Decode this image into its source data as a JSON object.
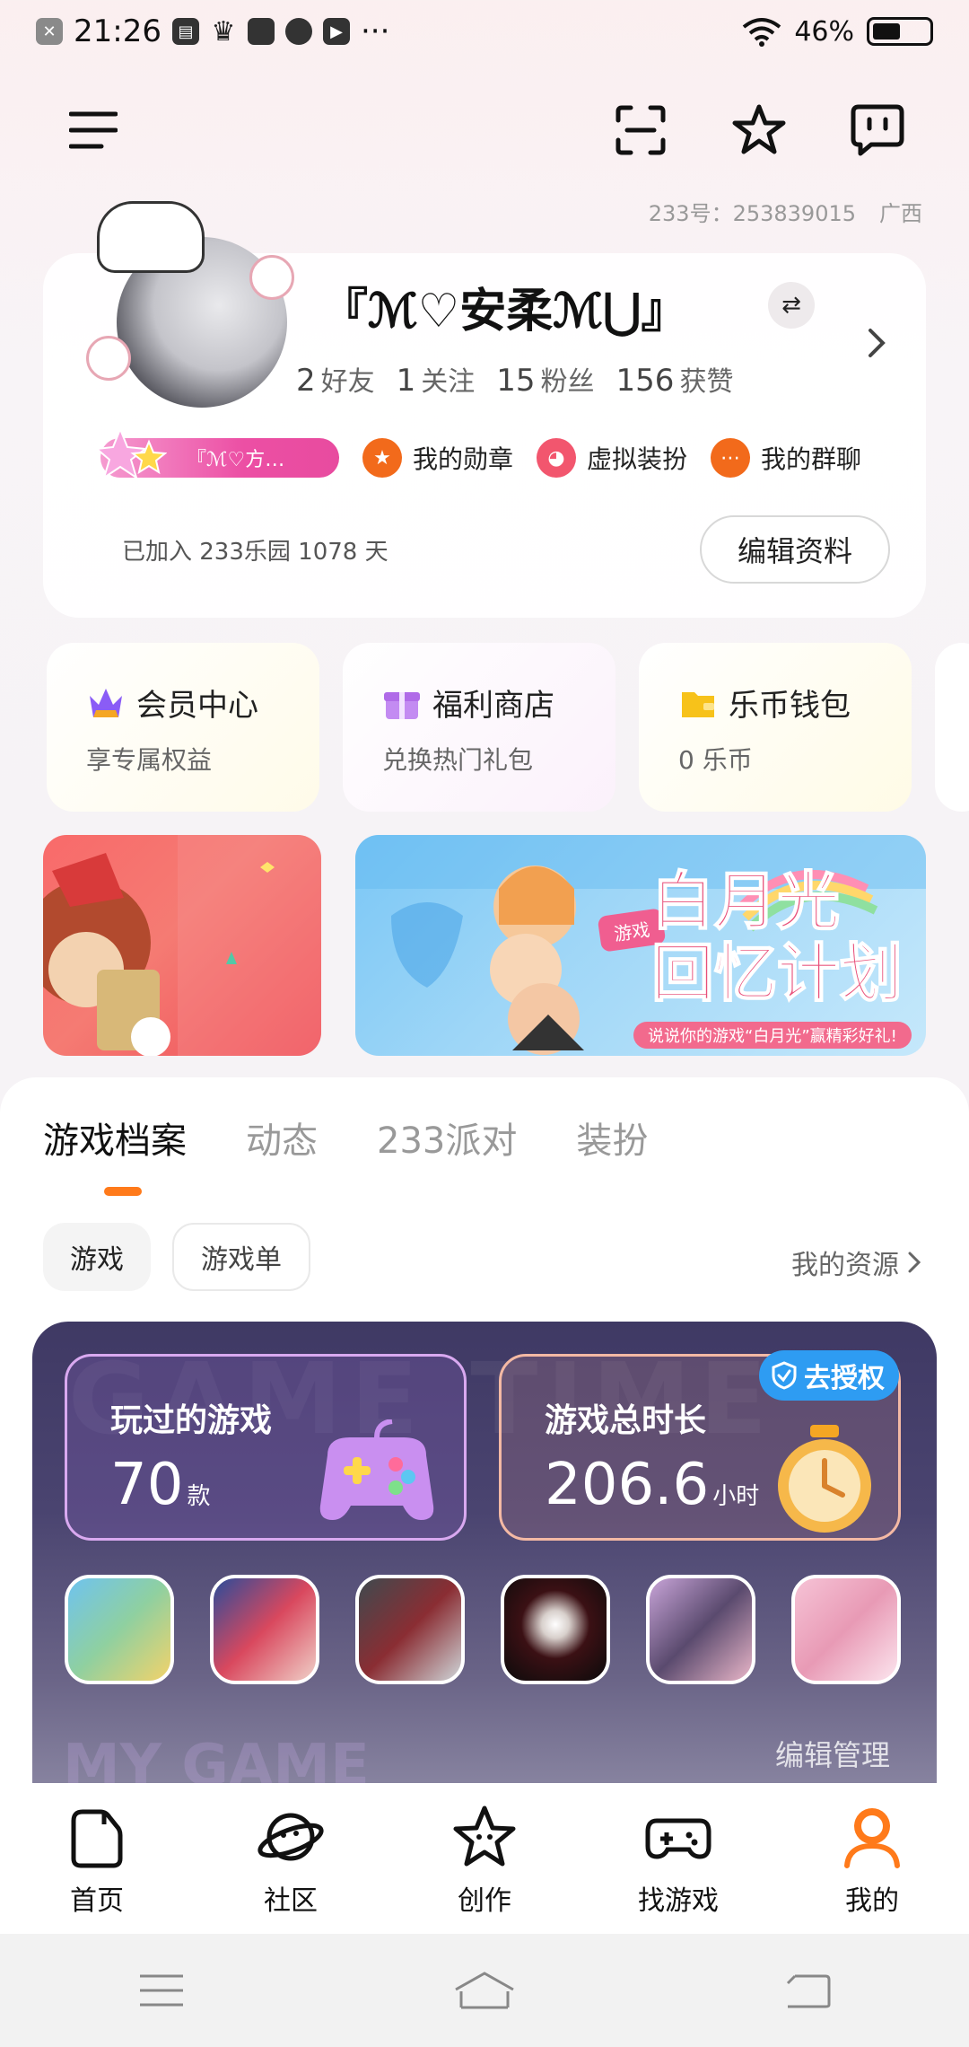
{
  "status_bar": {
    "time": "21:26",
    "battery": "46%",
    "more": "···"
  },
  "account": {
    "id_text": "233号：253839015",
    "region": "广西"
  },
  "profile": {
    "nickname": "『ℳ♡安柔ℳ⋃』",
    "stats": [
      {
        "value": "2",
        "label": "好友"
      },
      {
        "value": "1",
        "label": "关注"
      },
      {
        "value": "15",
        "label": "粉丝"
      },
      {
        "value": "156",
        "label": "获赞"
      }
    ],
    "vip_tag": "『ℳ♡方…",
    "badges": [
      {
        "label": "我的勋章",
        "color": "#f26a1b"
      },
      {
        "label": "虚拟装扮",
        "color": "#f2566e"
      },
      {
        "label": "我的群聊",
        "color": "#f26a1b"
      }
    ],
    "joined": "已加入 233乐园 1078 天",
    "edit_button": "编辑资料"
  },
  "quick_cards": [
    {
      "title": "会员中心",
      "subtitle": "享专属权益"
    },
    {
      "title": "福利商店",
      "subtitle": "兑换热门礼包"
    },
    {
      "title": "乐币钱包",
      "subtitle": "0 乐币"
    }
  ],
  "banner": {
    "title_line1": "白月光",
    "title_line2": "回忆计划",
    "tag": "游戏",
    "footer": "说说你的游戏“白月光”赢精彩好礼!"
  },
  "tabs": [
    {
      "label": "游戏档案",
      "active": true
    },
    {
      "label": "动态",
      "active": false
    },
    {
      "label": "233派对",
      "active": false
    },
    {
      "label": "装扮",
      "active": false
    }
  ],
  "chips": [
    {
      "label": "游戏",
      "active": true
    },
    {
      "label": "游戏单",
      "active": false
    }
  ],
  "my_resources": "我的资源",
  "game_panel": {
    "watermark_top": "GAME TIME",
    "watermark_bottom": "MY GAME",
    "played": {
      "title": "玩过的游戏",
      "value": "70",
      "unit": "款"
    },
    "time": {
      "title": "游戏总时长",
      "value": "206.6",
      "unit": "小时"
    },
    "authorize": "去授权",
    "edit_manage": "编辑管理"
  },
  "bottom_nav": [
    {
      "label": "首页"
    },
    {
      "label": "社区"
    },
    {
      "label": "创作"
    },
    {
      "label": "找游戏"
    },
    {
      "label": "我的"
    }
  ]
}
